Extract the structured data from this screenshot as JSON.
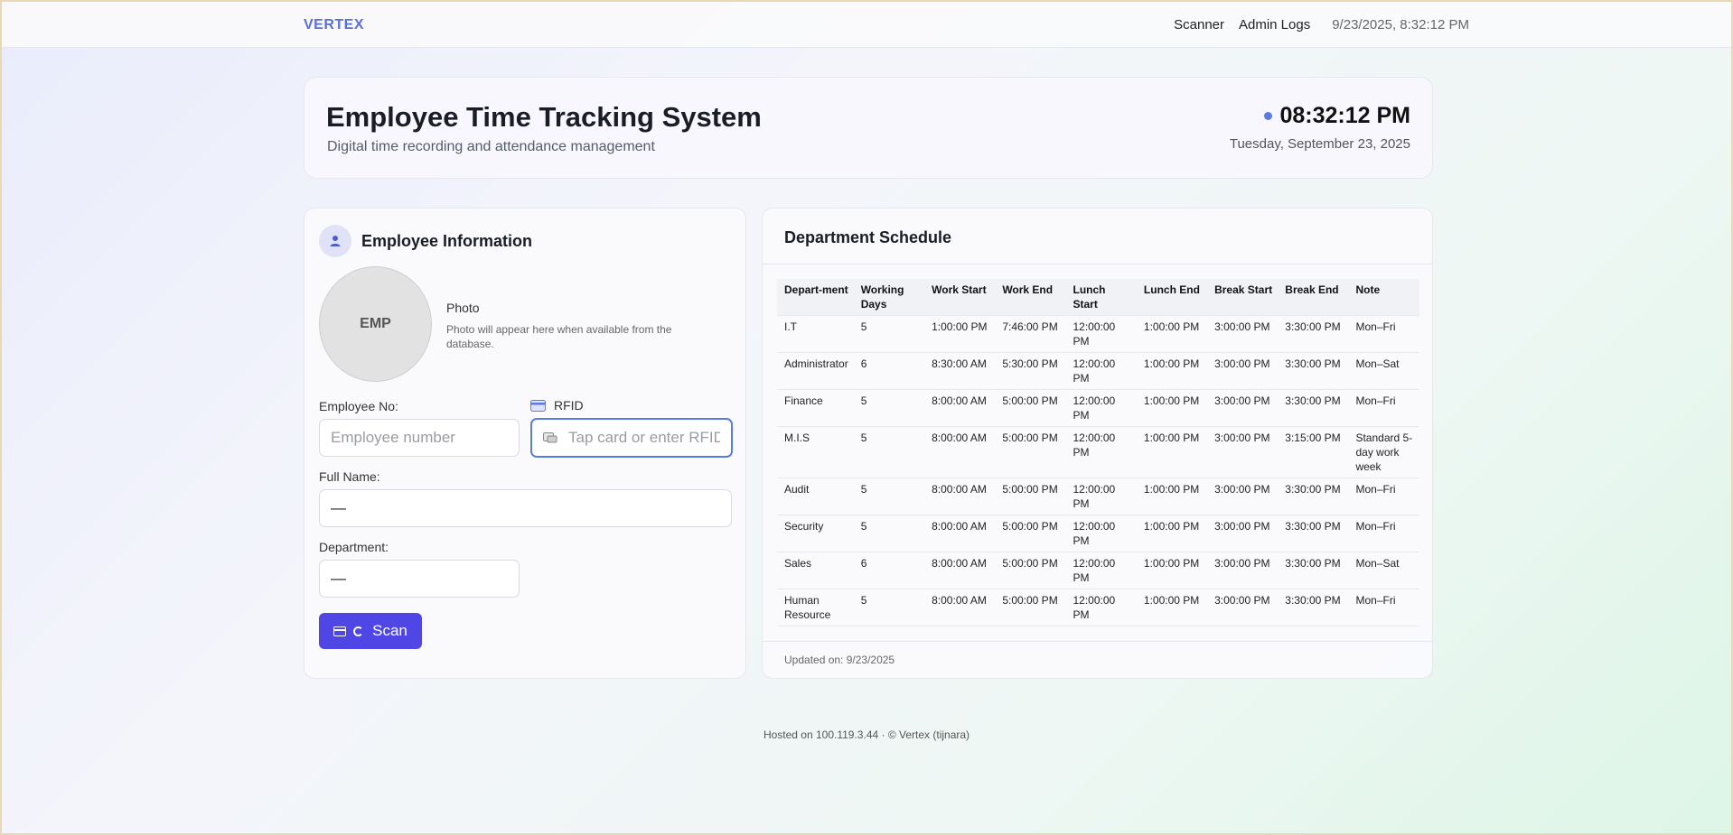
{
  "topbar": {
    "brand": "VERTEX",
    "nav": [
      {
        "label": "Scanner"
      },
      {
        "label": "Admin Logs"
      }
    ],
    "timestamp": "9/23/2025, 8:32:12 PM"
  },
  "hero": {
    "title": "Employee Time Tracking System",
    "subtitle": "Digital time recording and attendance management",
    "time": "08:32:12 PM",
    "date": "Tuesday, September 23, 2025",
    "dot_color": "#5a7be0"
  },
  "employee": {
    "title": "Employee Information",
    "icon": "user-icon",
    "photo_placeholder": "EMP",
    "photo_label": "Photo",
    "photo_desc": "Photo will appear here when available from the database.",
    "emp_no_label": "Employee No:",
    "emp_no_placeholder": "Employee number",
    "rfid_label": "RFID",
    "rfid_placeholder": "Tap card or enter RFID",
    "full_name_label": "Full Name:",
    "full_name_value": "—",
    "department_label": "Department:",
    "department_value": "—",
    "scan_label": "Scan",
    "accent": "#4f46e5"
  },
  "schedule": {
    "title": "Department Schedule",
    "columns": [
      "Depart-ment",
      "Working Days",
      "Work Start",
      "Work End",
      "Lunch Start",
      "Lunch End",
      "Break Start",
      "Break End",
      "Note"
    ],
    "rows": [
      [
        "I.T",
        "5",
        "1:00:00 PM",
        "7:46:00 PM",
        "12:00:00 PM",
        "1:00:00 PM",
        "3:00:00 PM",
        "3:30:00 PM",
        "Mon–Fri"
      ],
      [
        "Administrator",
        "6",
        "8:30:00 AM",
        "5:30:00 PM",
        "12:00:00 PM",
        "1:00:00 PM",
        "3:00:00 PM",
        "3:30:00 PM",
        "Mon–Sat"
      ],
      [
        "Finance",
        "5",
        "8:00:00 AM",
        "5:00:00 PM",
        "12:00:00 PM",
        "1:00:00 PM",
        "3:00:00 PM",
        "3:30:00 PM",
        "Mon–Fri"
      ],
      [
        "M.I.S",
        "5",
        "8:00:00 AM",
        "5:00:00 PM",
        "12:00:00 PM",
        "1:00:00 PM",
        "3:00:00 PM",
        "3:15:00 PM",
        "Standard 5-day work week"
      ],
      [
        "Audit",
        "5",
        "8:00:00 AM",
        "5:00:00 PM",
        "12:00:00 PM",
        "1:00:00 PM",
        "3:00:00 PM",
        "3:30:00 PM",
        "Mon–Fri"
      ],
      [
        "Security",
        "5",
        "8:00:00 AM",
        "5:00:00 PM",
        "12:00:00 PM",
        "1:00:00 PM",
        "3:00:00 PM",
        "3:30:00 PM",
        "Mon–Fri"
      ],
      [
        "Sales",
        "6",
        "8:00:00 AM",
        "5:00:00 PM",
        "12:00:00 PM",
        "1:00:00 PM",
        "3:00:00 PM",
        "3:30:00 PM",
        "Mon–Sat"
      ],
      [
        "Human Resource",
        "5",
        "8:00:00 AM",
        "5:00:00 PM",
        "12:00:00 PM",
        "1:00:00 PM",
        "3:00:00 PM",
        "3:30:00 PM",
        "Mon–Fri"
      ]
    ],
    "updated": "Updated on: 9/23/2025"
  },
  "footer": "Hosted on 100.119.3.44 · © Vertex (tijnara)"
}
